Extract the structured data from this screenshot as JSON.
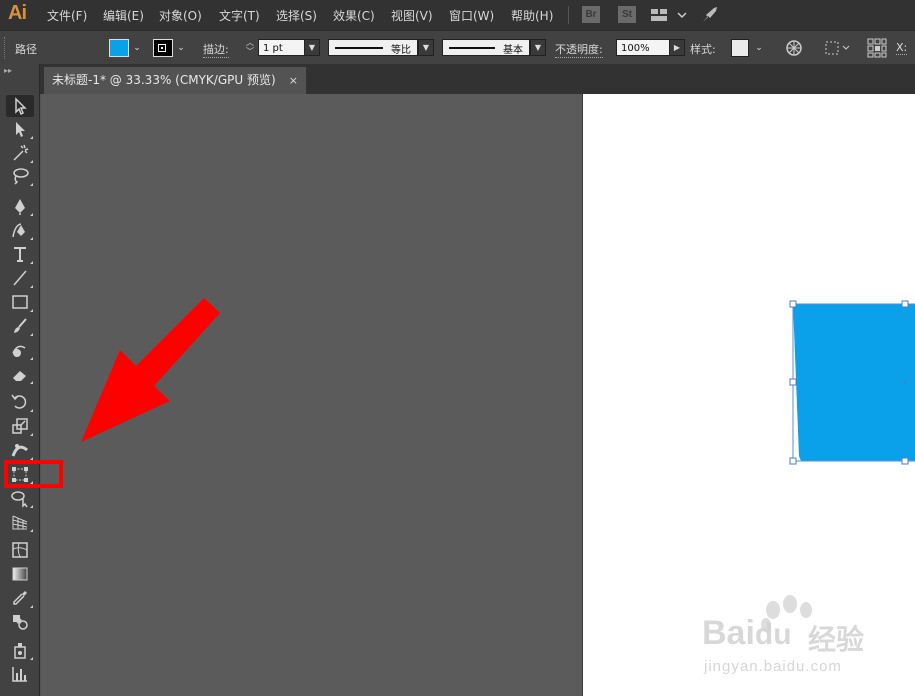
{
  "app": {
    "logo": "Ai"
  },
  "menu": {
    "items": [
      {
        "label": "文件(F)"
      },
      {
        "label": "编辑(E)"
      },
      {
        "label": "对象(O)"
      },
      {
        "label": "文字(T)"
      },
      {
        "label": "选择(S)"
      },
      {
        "label": "效果(C)"
      },
      {
        "label": "视图(V)"
      },
      {
        "label": "窗口(W)"
      },
      {
        "label": "帮助(H)"
      }
    ],
    "badges": {
      "bridge": "Br",
      "stock": "St"
    }
  },
  "control_bar": {
    "selection_label": "路径",
    "stroke_label": "描边:",
    "stroke_weight": "1 pt",
    "profile_label": "等比",
    "brush_label": "基本",
    "opacity_label": "不透明度:",
    "opacity_value": "100%",
    "style_label": "样式:",
    "x_label": "X:"
  },
  "document_tab": {
    "title": "未标题-1* @ 33.33% (CMYK/GPU 预览)",
    "close": "×"
  },
  "colors": {
    "accent_fill": "#0aa0ea",
    "highlight": "#ff0000",
    "menu_bg": "#323232",
    "panel_bg": "#424242",
    "canvas_bg": "#5b5b5b"
  },
  "tools": [
    {
      "name": "selection-tool",
      "icon": "selection-arrow-icon"
    },
    {
      "name": "direct-selection-tool",
      "icon": "direct-selection-arrow-icon"
    },
    {
      "name": "magic-wand-tool",
      "icon": "magic-wand-icon"
    },
    {
      "name": "lasso-tool",
      "icon": "lasso-icon"
    },
    {
      "name": "pen-tool",
      "icon": "pen-icon"
    },
    {
      "name": "curvature-tool",
      "icon": "curvature-pen-icon"
    },
    {
      "name": "type-tool",
      "icon": "type-icon"
    },
    {
      "name": "line-tool",
      "icon": "line-icon"
    },
    {
      "name": "rectangle-tool",
      "icon": "rectangle-icon"
    },
    {
      "name": "paintbrush-tool",
      "icon": "paintbrush-icon"
    },
    {
      "name": "shaper-tool",
      "icon": "shaper-icon"
    },
    {
      "name": "eraser-tool",
      "icon": "eraser-icon"
    },
    {
      "name": "rotate-tool",
      "icon": "rotate-icon"
    },
    {
      "name": "scale-tool",
      "icon": "scale-icon"
    },
    {
      "name": "warp-tool",
      "icon": "warp-icon"
    },
    {
      "name": "free-transform-tool",
      "icon": "free-transform-icon"
    },
    {
      "name": "shape-builder-tool",
      "icon": "shape-builder-icon"
    },
    {
      "name": "perspective-grid-tool",
      "icon": "perspective-grid-icon"
    },
    {
      "name": "mesh-tool",
      "icon": "mesh-icon"
    },
    {
      "name": "gradient-tool",
      "icon": "gradient-icon"
    },
    {
      "name": "eyedropper-tool",
      "icon": "eyedropper-icon"
    },
    {
      "name": "blend-tool",
      "icon": "blend-icon"
    },
    {
      "name": "symbol-sprayer-tool",
      "icon": "symbol-sprayer-icon"
    },
    {
      "name": "column-graph-tool",
      "icon": "column-graph-icon"
    }
  ],
  "watermark": {
    "brand": "Bai",
    "brand_cn": "经验",
    "url": "jingyan.baidu.com"
  }
}
